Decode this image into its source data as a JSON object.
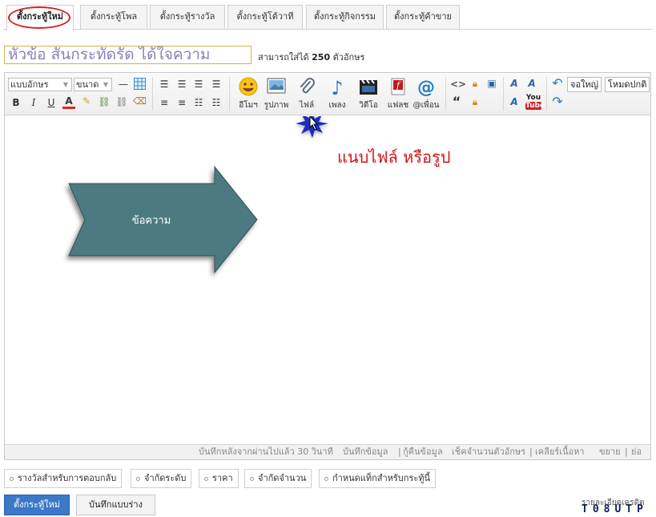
{
  "tabs": [
    {
      "label": "ตั้งกระทู้ใหม่",
      "active": true
    },
    {
      "label": "ตั้งกระทู้โพล"
    },
    {
      "label": "ตั้งกระทู้รางวัล"
    },
    {
      "label": "ตั้งกระทู้โต้วาที"
    },
    {
      "label": "ตั้งกระทู้กิจกรรม"
    },
    {
      "label": "ตั้งกระทู้ค้าขาย"
    }
  ],
  "title": {
    "value": "หัวข้อ สั้นกระทัดรัด ได้ใจความ",
    "hint_prefix": "สามารถใส่ได้",
    "hint_count": "250",
    "hint_suffix": "ตัวอักษร"
  },
  "toolbar": {
    "font_select": "แบบอักษร",
    "size_select": "ขนาด",
    "format_buttons": {
      "bold": "B",
      "italic": "I",
      "underline": "U",
      "color": "A"
    },
    "media": [
      {
        "label": "อีโมฯ",
        "icon": "smiley-icon"
      },
      {
        "label": "รูปภาพ",
        "icon": "image-icon"
      },
      {
        "label": "ไฟล์",
        "icon": "paperclip-icon"
      },
      {
        "label": "เพลง",
        "icon": "music-note-icon"
      },
      {
        "label": "วิดีโอ",
        "icon": "clapperboard-icon"
      },
      {
        "label": "แฟลช",
        "icon": "flash-icon"
      },
      {
        "label": "@เพื่อน",
        "icon": "at-icon"
      }
    ],
    "fullsize_button": "จอใหญ่",
    "mode_button": "โหมดปกติ",
    "youtube_badge_top": "You",
    "youtube_badge_bottom": "Tube",
    "code_icon": "<>",
    "quote_icon": "“"
  },
  "content": {
    "annotation": "แนบไฟล์ หรือรูป",
    "arrow_label": "ข้อความ"
  },
  "statusbar": {
    "autosave": "บันทึกหลังจากผ่านไปแล้ว 30 วินาที",
    "save_link": "บันทึกข้อมูล",
    "divider": "|",
    "restore_link": "กู้คืนข้อมูล",
    "check_link": "เช็คจำนวนตัวอักษร",
    "clear_link": "เคลียร์เนื้อหา",
    "expand_link": "ขยาย",
    "shrink_link": "ย่อ"
  },
  "options": [
    "รางวัลสำหรับการตอบกลับ",
    "จำกัดระดับ",
    "ราคา",
    "จำกัดจำนวน",
    "กำหนดแท็กสำหรับกระทู้นี้"
  ],
  "actions": {
    "submit": "ตั้งกระทู้ใหม่",
    "draft": "บันทึกแบบร่าง"
  },
  "footer": {
    "text": "รายละเอียดเครดิต",
    "logo": "T08UTP"
  },
  "colors": {
    "arrow_fill": "#4e7a80",
    "annotation": "#d01515",
    "primary_button": "#3b78c8",
    "tab_circle": "#d92020"
  }
}
